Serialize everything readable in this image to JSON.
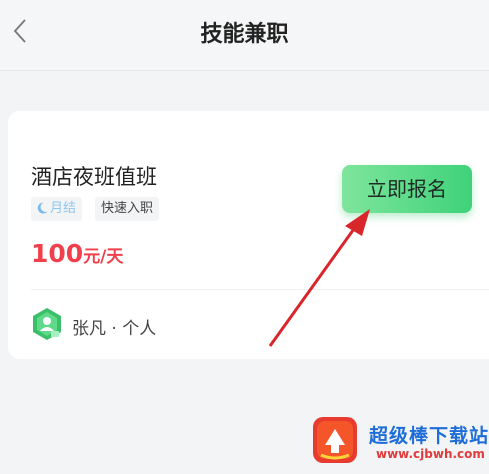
{
  "header": {
    "title": "技能兼职",
    "back_icon": "chevron-left-icon"
  },
  "job": {
    "title": "酒店夜班值班",
    "tags": [
      "月结",
      "快速入职"
    ],
    "salary": {
      "amount": "100",
      "unit": "元/天"
    },
    "apply_label": "立即报名",
    "author": "张凡 · 个人",
    "avatar_icon": "person-shield-icon"
  },
  "watermark": {
    "brand": "超级棒下载站",
    "url": "www.cjbwh.com"
  },
  "colors": {
    "accent_green": "#4cd784",
    "salary_red": "#f0404b",
    "arrow_red": "#d9262a",
    "watermark_blue": "#1e6dd8"
  }
}
